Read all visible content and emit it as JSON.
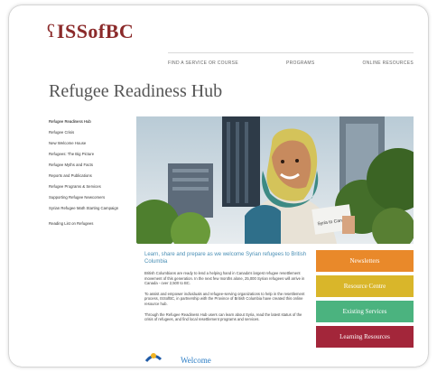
{
  "brand": {
    "name": "ISSofBC",
    "mark": "ʕ"
  },
  "nav": [
    "FIND A SERVICE OR COURSE",
    "PROGRAMS",
    "ONLINE RESOURCES"
  ],
  "page_title": "Refugee Readiness Hub",
  "sidebar": [
    "Refugee Readiness Hub",
    "Refugee Crisis",
    "New Welcome House",
    "Refugees: The Big Picture",
    "Refugee Myths and Facts",
    "Reports and Publications",
    "Refugee Programs & Services",
    "Supporting Refugee Newcomers",
    "Syrian Refugee Math Starting Campaign",
    "Reading List on Refugees"
  ],
  "hero": {
    "book_text": "Syria to Canada"
  },
  "intro": {
    "lead": "Learn, share and prepare as we welcome Syrian refugees to British Columbia",
    "paragraphs": [
      "British Columbians are ready to lend a helping hand in Canada's largest refugee resettlement movement of this generation. In the next few months alone, 25,000 Syrian refugees will arrive in Canada - over 2,500 to BC.",
      "To assist and empower individuals and refugee-serving organizations to help in the resettlement process, ISSofBC, in partnership with the Province of British Columbia have created this online resource hub.",
      "Through the Refugee Readiness Hub users can learn about Syria, read the latest status of the crisis of refugees, and find local resettlement programs and services."
    ]
  },
  "buttons": [
    {
      "label": "Newsletters",
      "color": "#e9892a"
    },
    {
      "label": "Resource Centre",
      "color": "#d9b62a"
    },
    {
      "label": "Existing Services",
      "color": "#4bb37f"
    },
    {
      "label": "Learning Resources",
      "color": "#a3263a"
    }
  ],
  "footer_logo_text": "Welcome"
}
